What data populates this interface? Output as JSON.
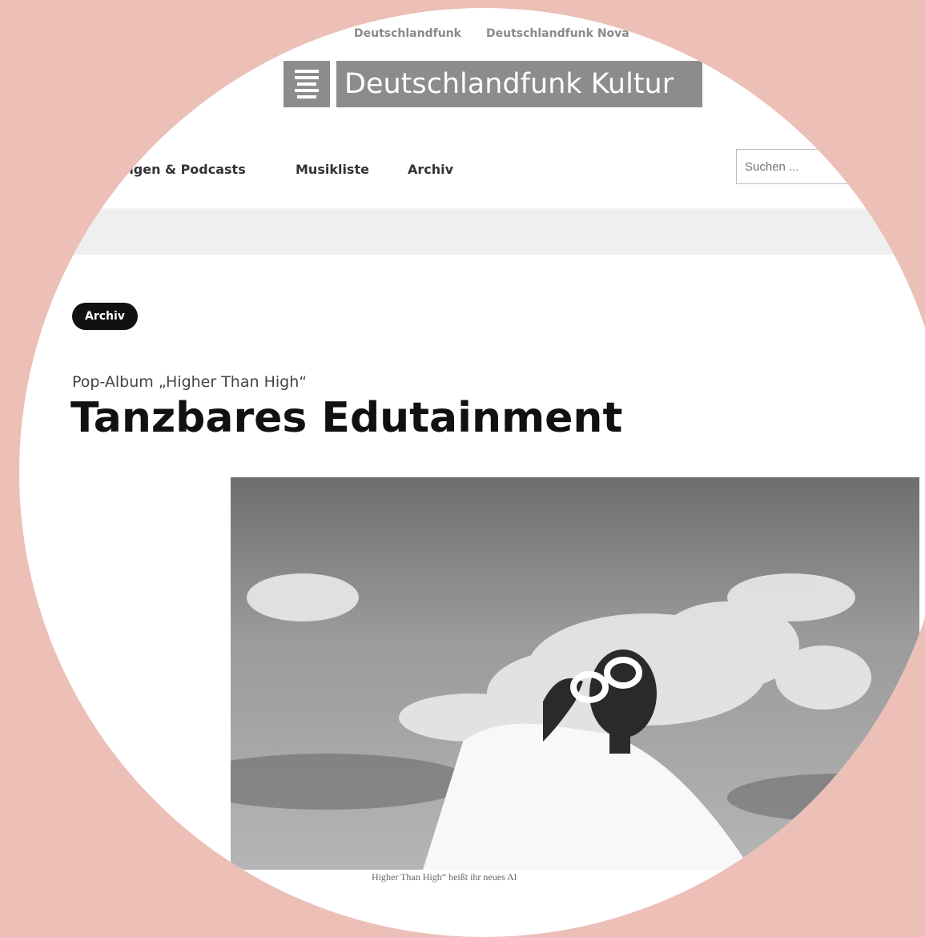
{
  "topbar": {
    "links": [
      "Deutschlandfunk",
      "Deutschlandfunk Nova"
    ]
  },
  "brand": {
    "name": "Deutschlandfunk Kultur"
  },
  "nav": {
    "items": [
      "ungen & Podcasts",
      "Musikliste",
      "Archiv"
    ],
    "search_placeholder": "Suchen ..."
  },
  "article": {
    "badge": "Archiv",
    "kicker": "Pop-Album „Higher Than High“",
    "title": "Tanzbares Edutainment",
    "caption": "Higher Than High“ heißt ihr neues Al"
  },
  "colors": {
    "background": "#ecbfb7",
    "logo": "#8c8c8c",
    "badge": "#111111"
  },
  "icons": {
    "logo": "radio-logo-icon"
  }
}
